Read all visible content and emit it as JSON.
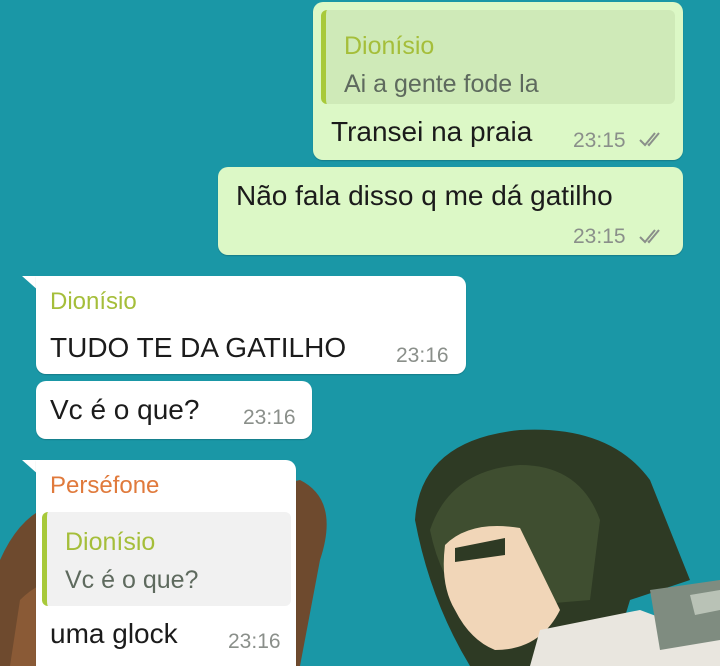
{
  "colors": {
    "background": "#1a97a6",
    "outgoing_bubble": "#dcf8c6",
    "incoming_bubble": "#ffffff",
    "quote_accent": "#a8c93a",
    "sender_dionisio": "#a5be3a",
    "sender_persefone": "#e07a3c",
    "timestamp": "#8a8f8a"
  },
  "messages": [
    {
      "direction": "outgoing",
      "reply_to": {
        "name": "Dionísio",
        "text": "Ai a gente fode la"
      },
      "text": "Transei na praia",
      "time": "23:15",
      "status_icon": "double-check-icon"
    },
    {
      "direction": "outgoing",
      "text": "Não fala disso q me dá gatilho",
      "time": "23:15",
      "status_icon": "double-check-icon"
    },
    {
      "direction": "incoming",
      "sender": "Dionísio",
      "text": "TUDO TE DA GATILHO",
      "time": "23:16"
    },
    {
      "direction": "incoming",
      "text": "Vc é o que?",
      "time": "23:16"
    },
    {
      "direction": "incoming",
      "sender": "Perséfone",
      "reply_to": {
        "name": "Dionísio",
        "text": "Vc é o que?"
      },
      "text": "uma glock",
      "time": "23:16"
    }
  ]
}
